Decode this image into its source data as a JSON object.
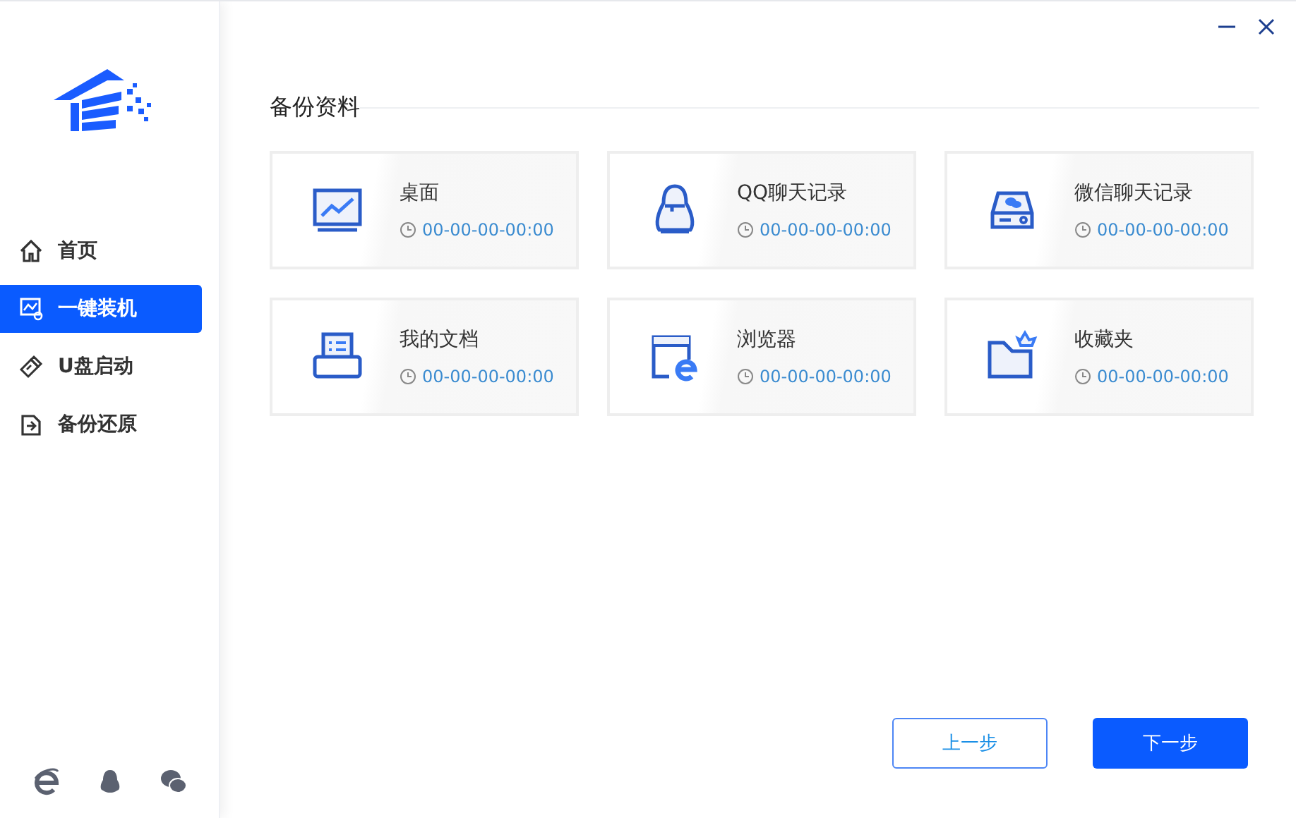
{
  "sidebar": {
    "items": [
      {
        "label": "首页",
        "kind": "home",
        "selected": false
      },
      {
        "label": "一键装机",
        "kind": "install",
        "selected": true
      },
      {
        "label": "U盘启动",
        "kind": "usb",
        "selected": false
      },
      {
        "label": "备份还原",
        "kind": "backup",
        "selected": false
      }
    ],
    "footer_icons": [
      {
        "kind": "browser"
      },
      {
        "kind": "qq"
      },
      {
        "kind": "wechat"
      }
    ]
  },
  "section": {
    "title": "备份资料"
  },
  "cards": [
    {
      "kind": "desktop",
      "title": "桌面",
      "time": "00-00-00-00:00"
    },
    {
      "kind": "qq",
      "title": "QQ聊天记录",
      "time": "00-00-00-00:00"
    },
    {
      "kind": "wechat",
      "title": "微信聊天记录",
      "time": "00-00-00-00:00"
    },
    {
      "kind": "docs",
      "title": "我的文档",
      "time": "00-00-00-00:00"
    },
    {
      "kind": "browser",
      "title": "浏览器",
      "time": "00-00-00-00:00"
    },
    {
      "kind": "favorites",
      "title": "收藏夹",
      "time": "00-00-00-00:00"
    }
  ],
  "buttons": [
    {
      "label": "上一步",
      "kind": "secondary"
    },
    {
      "label": "下一步",
      "kind": "primary"
    }
  ]
}
